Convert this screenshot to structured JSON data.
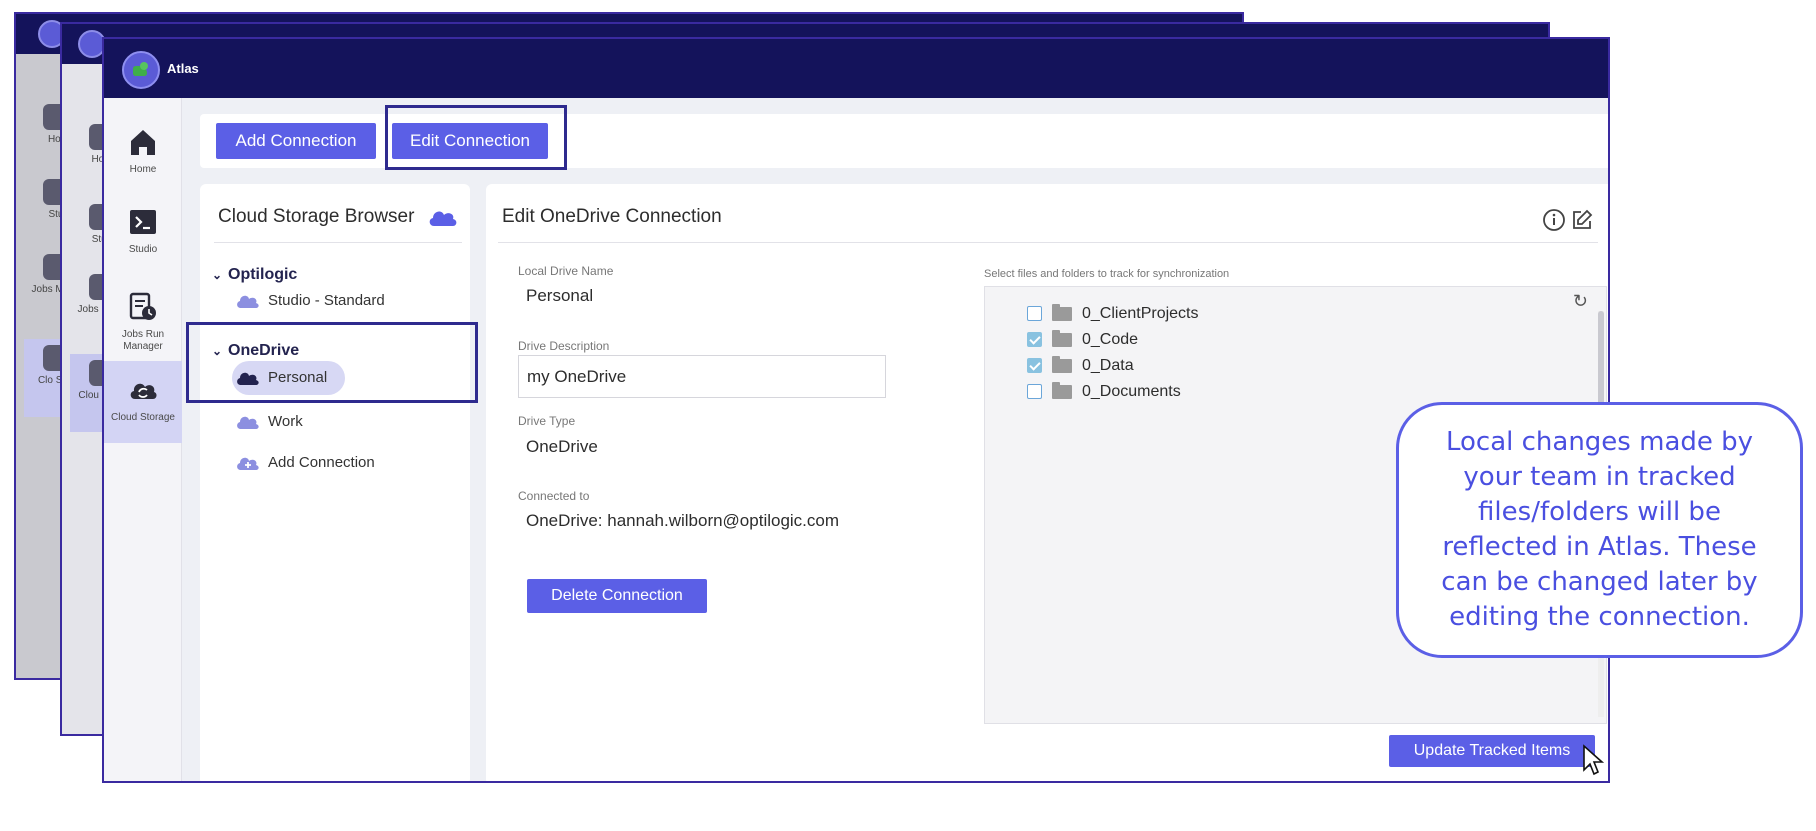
{
  "app": {
    "title": "Atlas"
  },
  "nav": {
    "items": [
      {
        "label": "Home",
        "icon": "home-icon"
      },
      {
        "label": "Studio",
        "icon": "terminal-icon"
      },
      {
        "label": "Jobs Run Manager",
        "icon": "jobs-icon"
      },
      {
        "label": "Cloud Storage",
        "icon": "cloud-sync-icon",
        "active": true
      }
    ]
  },
  "background_nav": {
    "back": [
      "Hor",
      "Stu",
      "Jobs Mana",
      "Clo Stor"
    ],
    "middle": [
      "Hom",
      "Stud",
      "Jobs Mana",
      "Clou Stora"
    ]
  },
  "toolbar": {
    "add_label": "Add Connection",
    "edit_label": "Edit Connection"
  },
  "browser": {
    "title": "Cloud Storage Browser",
    "groups": [
      {
        "name": "Optilogic",
        "items": [
          "Studio - Standard"
        ]
      },
      {
        "name": "OneDrive",
        "items": [
          "Personal",
          "Work"
        ]
      }
    ],
    "add_connection": "Add Connection",
    "selected": "Personal"
  },
  "panel": {
    "title": "Edit OneDrive Connection",
    "local_drive_name_label": "Local Drive Name",
    "local_drive_name": "Personal",
    "drive_description_label": "Drive Description",
    "drive_description": "my OneDrive",
    "drive_type_label": "Drive Type",
    "drive_type": "OneDrive",
    "connected_to_label": "Connected to",
    "connected_to": "OneDrive: hannah.wilborn@optilogic.com",
    "delete_label": "Delete Connection",
    "sync_label": "Select files and folders to track for synchronization",
    "files": [
      {
        "name": "0_ClientProjects",
        "checked": false
      },
      {
        "name": "0_Code",
        "checked": true
      },
      {
        "name": "0_Data",
        "checked": true
      },
      {
        "name": "0_Documents",
        "checked": false
      }
    ],
    "update_label": "Update Tracked Items"
  },
  "callout": {
    "text": "Local changes made by your team in tracked files/folders will be reflected in Atlas. These can be changed later by editing the connection."
  },
  "colors": {
    "accent": "#5b5fe6",
    "topbar": "#14135b",
    "highlight_border": "#2e2a8e"
  }
}
